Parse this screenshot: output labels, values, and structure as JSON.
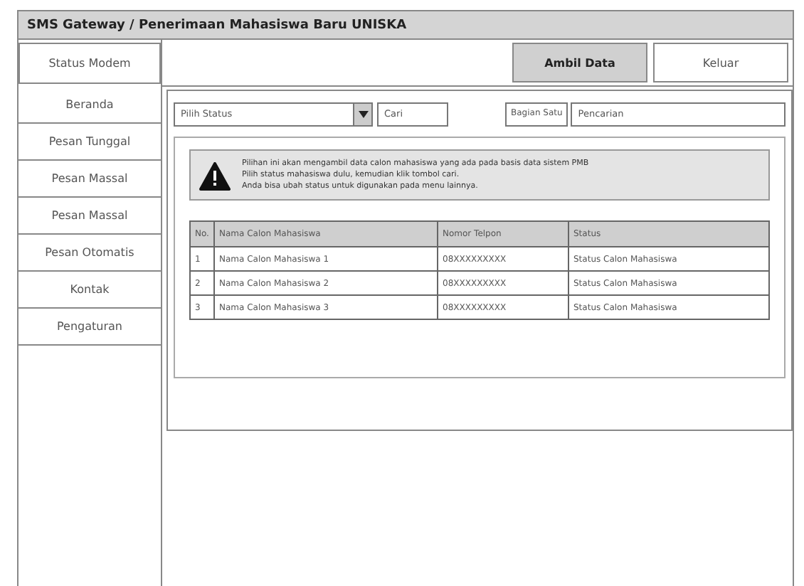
{
  "window": {
    "title": "SMS Gateway / Penerimaan Mahasiswa Baru UNISKA"
  },
  "sidebar": {
    "status_button": "Status Modem",
    "items": [
      {
        "label": "Beranda"
      },
      {
        "label": "Pesan Tunggal"
      },
      {
        "label": "Pesan Massal"
      },
      {
        "label": "Pesan Massal"
      },
      {
        "label": "Pesan Otomatis"
      },
      {
        "label": "Kontak"
      },
      {
        "label": "Pengaturan"
      }
    ]
  },
  "toolbar": {
    "buttons": [
      {
        "label": "Ambil Data",
        "selected": true
      },
      {
        "label": "Keluar",
        "selected": false
      }
    ]
  },
  "filter": {
    "status_select": "Pilih Status",
    "search_button": "Cari",
    "label": "Bagian Satu",
    "search_field": "Pencarian"
  },
  "alert": {
    "lines": [
      "Pilihan ini akan mengambil data calon mahasiswa yang ada pada basis data sistem PMB",
      "Pilih status mahasiswa dulu, kemudian klik tombol cari.",
      "Anda bisa ubah status untuk digunakan pada menu lainnya."
    ]
  },
  "table": {
    "columns": [
      "No.",
      "Nama Calon Mahasiswa",
      "Nomor Telpon",
      "Status"
    ],
    "rows": [
      [
        "1",
        "Nama Calon Mahasiswa 1",
        "08XXXXXXXXX",
        "Status Calon Mahasiswa"
      ],
      [
        "2",
        "Nama Calon Mahasiswa 2",
        "08XXXXXXXXX",
        "Status Calon Mahasiswa"
      ],
      [
        "3",
        "Nama Calon Mahasiswa 3",
        "08XXXXXXXXX",
        "Status Calon Mahasiswa"
      ]
    ]
  }
}
